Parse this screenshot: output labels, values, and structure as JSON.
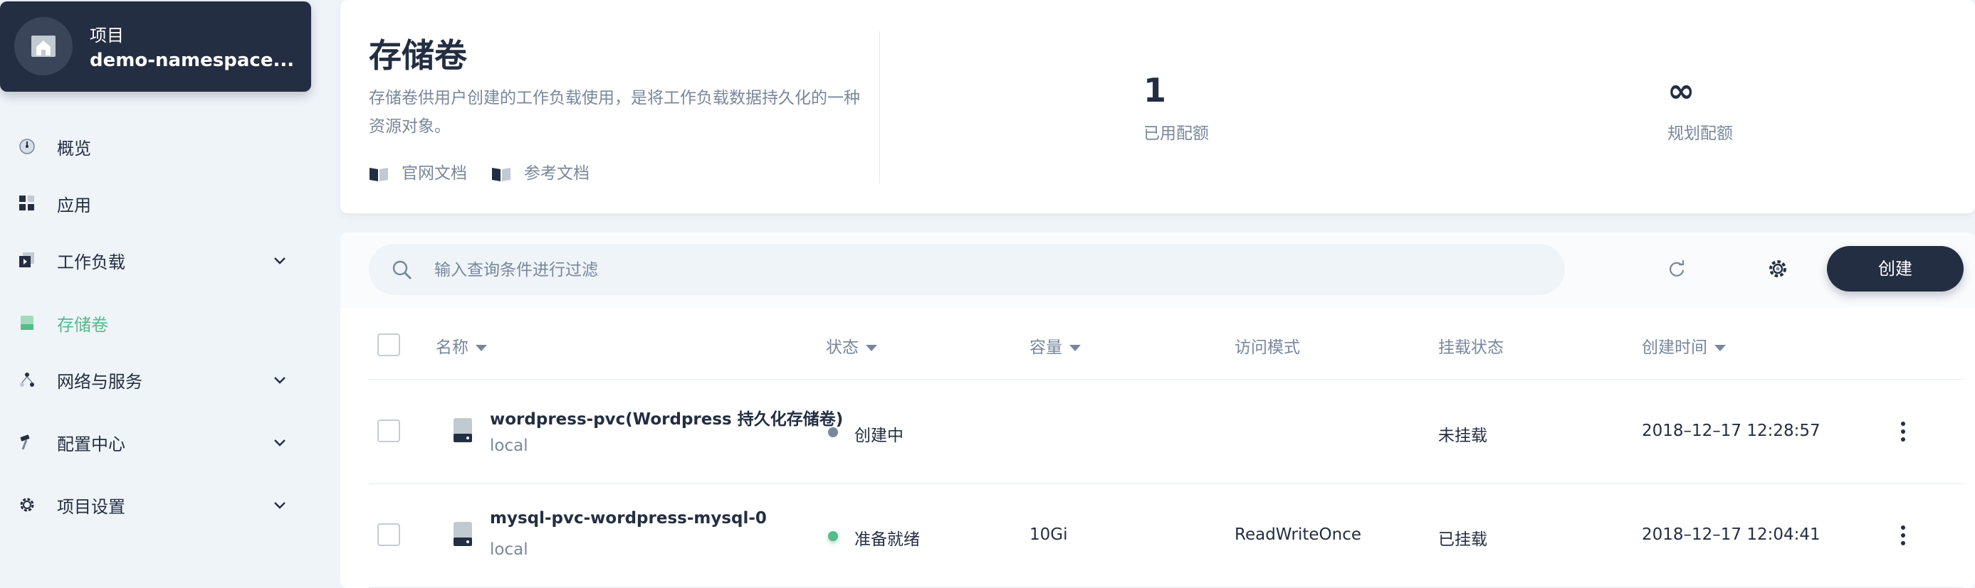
{
  "project": {
    "type_label": "项目",
    "name": "demo-namespace..."
  },
  "sidebar": {
    "items": [
      {
        "label": "概览",
        "icon": "dashboard-icon",
        "active": false,
        "expandable": false
      },
      {
        "label": "应用",
        "icon": "apps-grid-icon",
        "active": false,
        "expandable": false
      },
      {
        "label": "工作负载",
        "icon": "workload-icon",
        "active": false,
        "expandable": true
      },
      {
        "label": "存储卷",
        "icon": "storage-icon",
        "active": true,
        "expandable": false
      },
      {
        "label": "网络与服务",
        "icon": "network-icon",
        "active": false,
        "expandable": true
      },
      {
        "label": "配置中心",
        "icon": "hammer-icon",
        "active": false,
        "expandable": true
      },
      {
        "label": "项目设置",
        "icon": "gear-icon",
        "active": false,
        "expandable": true
      }
    ]
  },
  "header": {
    "title": "存储卷",
    "description": "存储卷供用户创建的工作负载使用，是将工作负载数据持久化的一种资源对象。",
    "links": [
      "官网文档",
      "参考文档"
    ],
    "quota_used_value": "1",
    "quota_used_label": "已用配额",
    "quota_plan_value": "∞",
    "quota_plan_label": "规划配额"
  },
  "toolbar": {
    "search_placeholder": "输入查询条件进行过滤",
    "create_label": "创建"
  },
  "table": {
    "columns": [
      "名称",
      "状态",
      "容量",
      "访问模式",
      "挂载状态",
      "创建时间"
    ],
    "rows": [
      {
        "name": "wordpress-pvc(Wordpress 持久化存储卷)",
        "storage_class": "local",
        "status": "创建中",
        "capacity": "",
        "access_mode": "",
        "mount_status": "未挂载",
        "created": "2018–12–17 12:28:57"
      },
      {
        "name": "mysql-pvc-wordpress-mysql-0",
        "storage_class": "local",
        "status": "准备就绪",
        "capacity": "10Gi",
        "access_mode": "ReadWriteOnce",
        "mount_status": "已挂载",
        "created": "2018–12–17 12:04:41"
      }
    ]
  },
  "colors": {
    "dark": "#242e42",
    "accent_green": "#55bc8a",
    "muted_text": "#79879c",
    "status_pending": "#79879c",
    "status_ready": "#55bc8a",
    "background": "#eff4f9"
  }
}
